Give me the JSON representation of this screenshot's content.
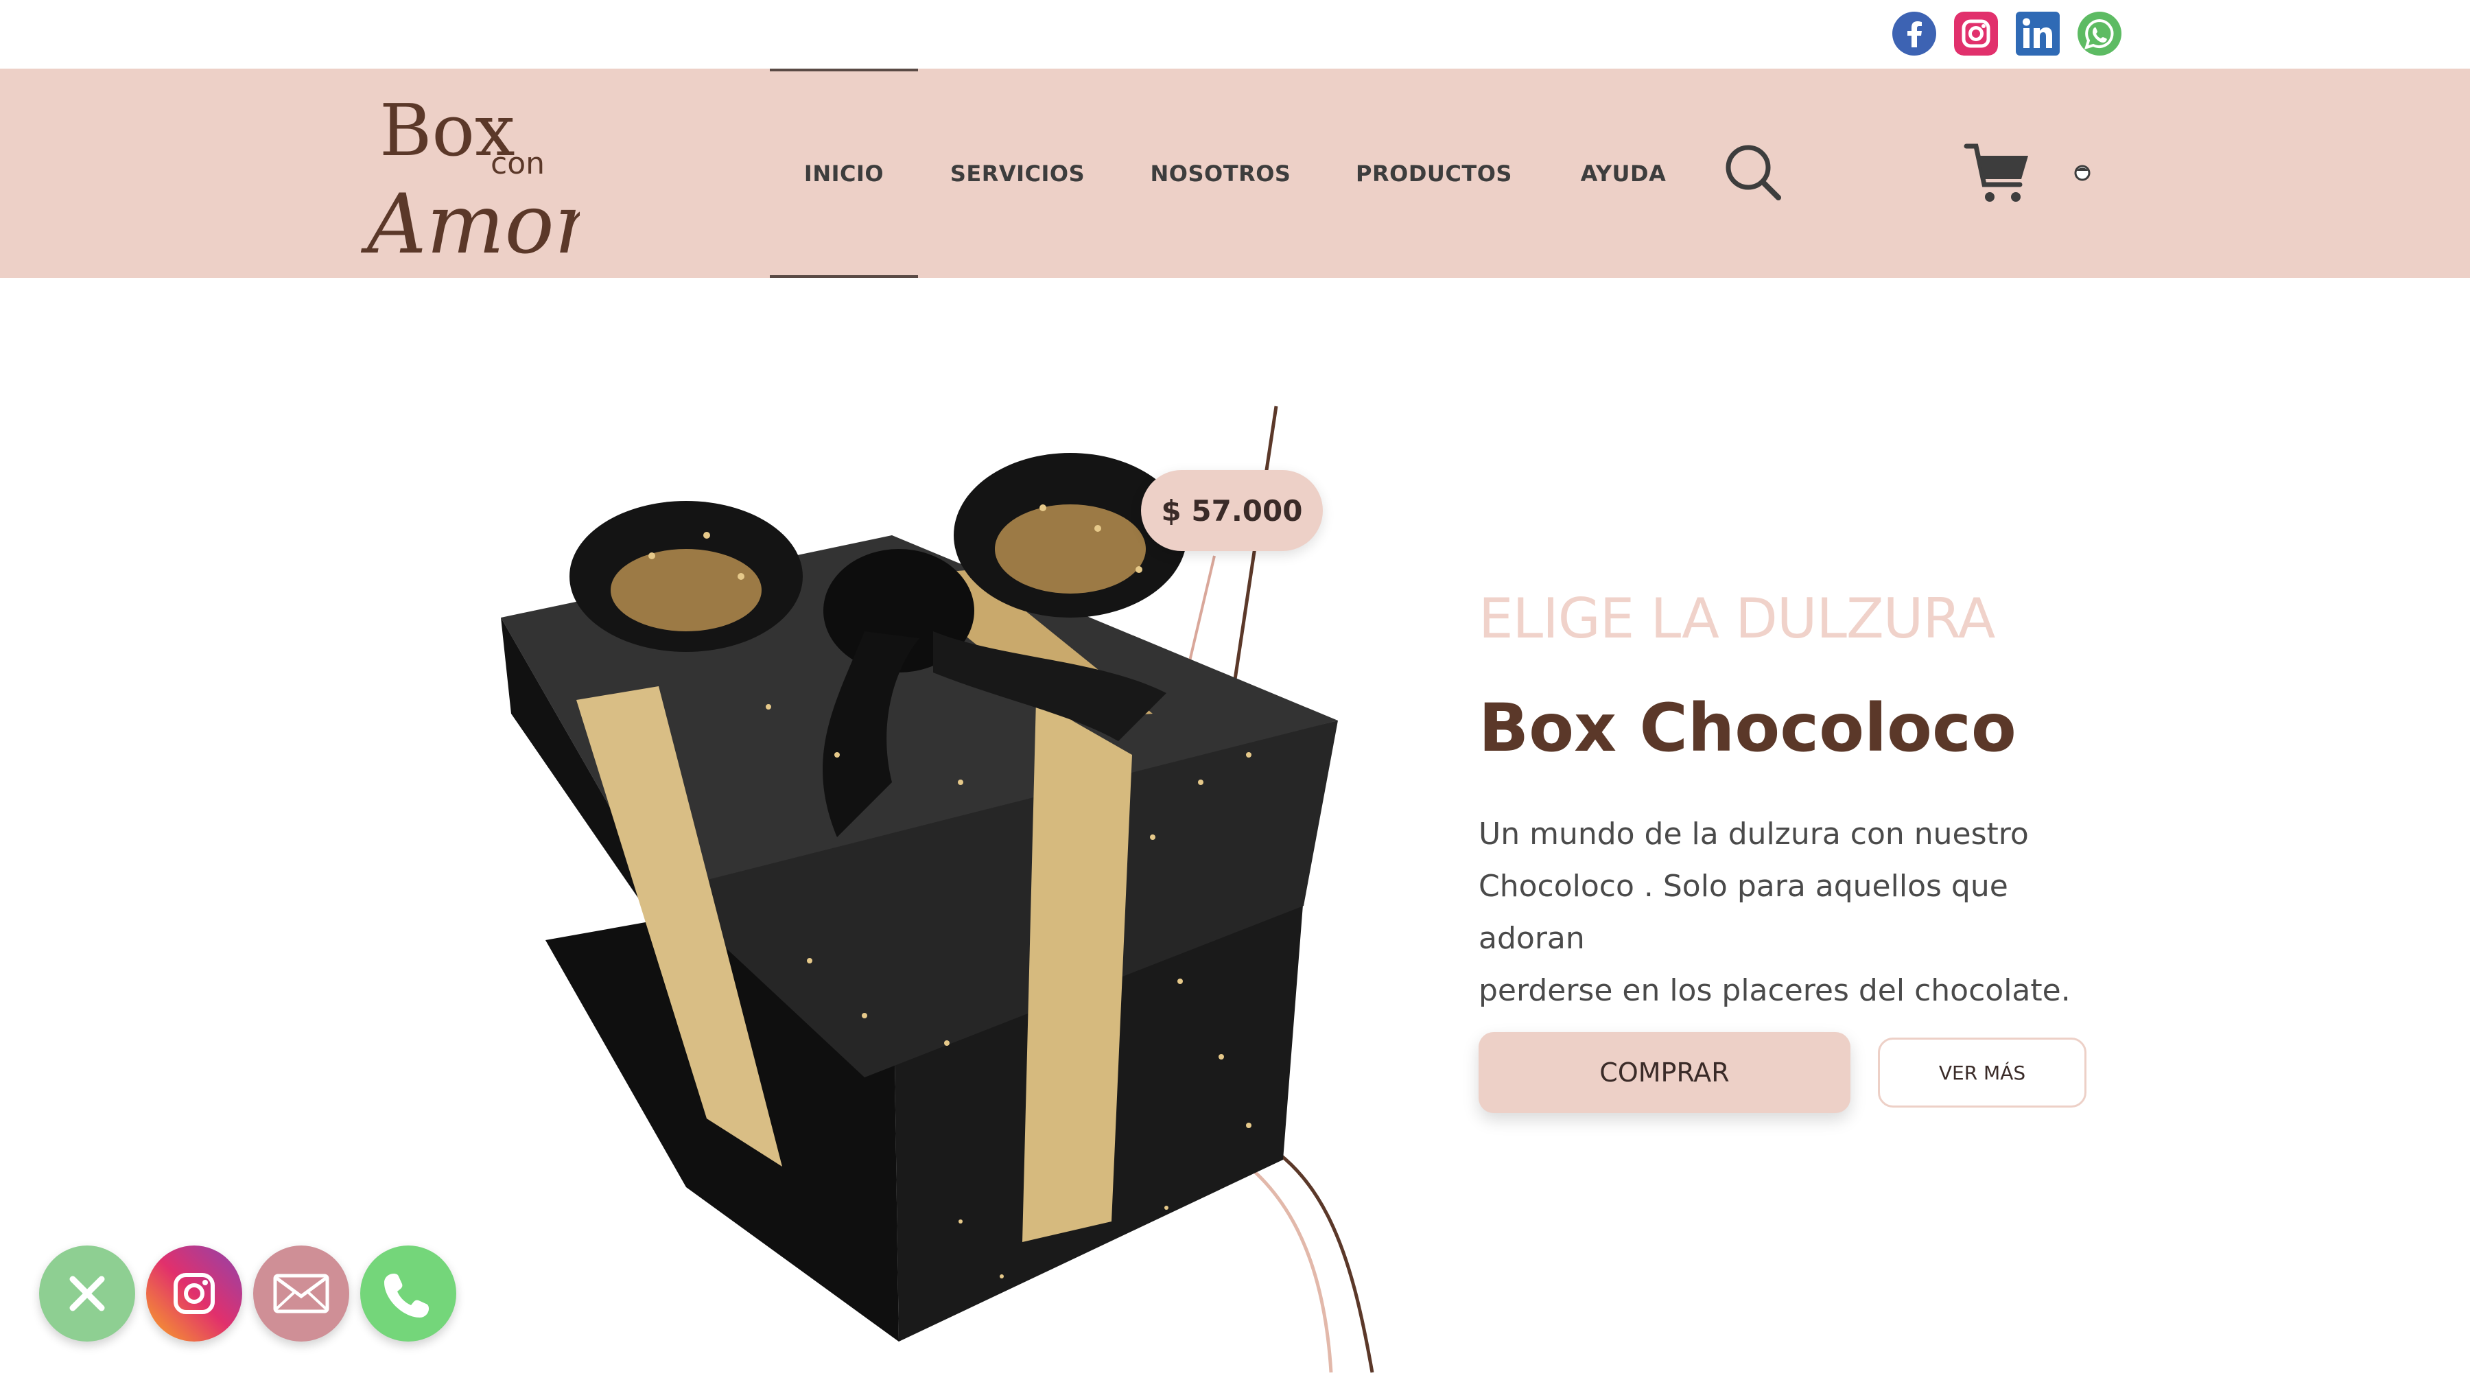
{
  "topbar": {
    "social": [
      {
        "name": "facebook-icon",
        "color": "#3b5998"
      },
      {
        "name": "instagram-icon",
        "color": "#e1306c"
      },
      {
        "name": "linkedin-icon",
        "color": "#0077b5"
      },
      {
        "name": "whatsapp-icon",
        "color": "#4caf50"
      }
    ]
  },
  "brand": {
    "logo_line1": "Box",
    "logo_line2": "con",
    "logo_line3": "Amor",
    "accent": "#edd0c7",
    "dark": "#5b3829"
  },
  "nav": {
    "items": [
      {
        "label": "INICIO",
        "active": true
      },
      {
        "label": "SERVICIOS"
      },
      {
        "label": "NOSOTROS"
      },
      {
        "label": "PRODUCTOS"
      },
      {
        "label": "AYUDA"
      }
    ],
    "icons": [
      "search-icon",
      "cart-icon",
      "user-icon"
    ]
  },
  "hero": {
    "price": "$ 57.000",
    "eyebrow": "ELIGE LA DULZURA",
    "title": "Box Chocoloco",
    "description_lines": [
      "Un mundo de la dulzura con nuestro",
      "Chocoloco . Solo para aquellos que adoran",
      "perderse en los placeres del chocolate."
    ],
    "buy_label": "COMPRAR",
    "more_label": "VER MÁS",
    "image": "gift-box-image"
  },
  "floating_actions": [
    {
      "name": "close-icon",
      "color": "#8ecf92"
    },
    {
      "name": "instagram-icon",
      "color": "#d6249f"
    },
    {
      "name": "mail-icon",
      "color": "#cf8f96"
    },
    {
      "name": "phone-icon",
      "color": "#74d67a"
    }
  ]
}
